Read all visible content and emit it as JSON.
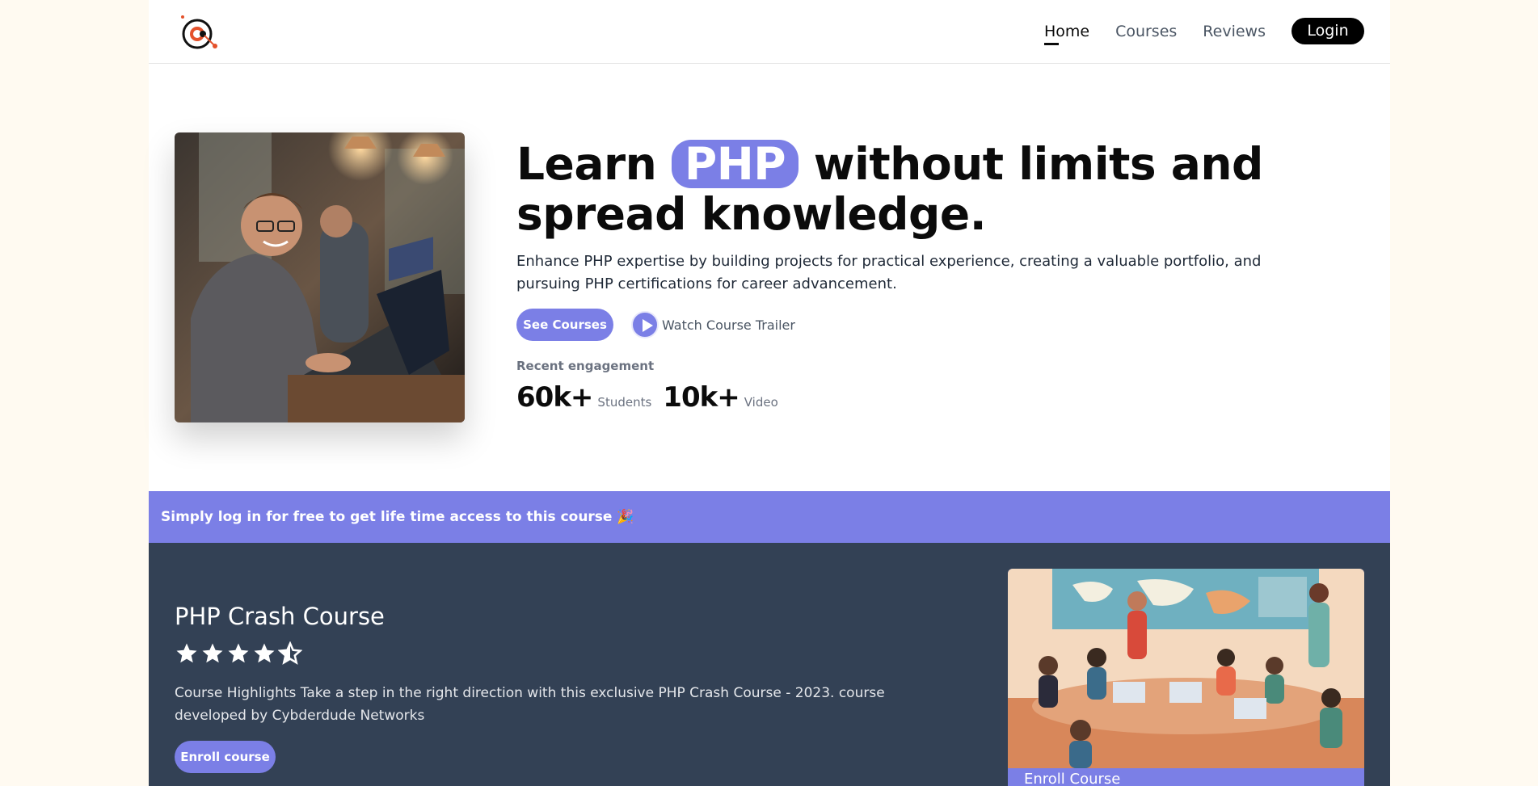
{
  "nav": {
    "links": [
      "Home",
      "Courses",
      "Reviews"
    ],
    "login_label": "Login"
  },
  "hero": {
    "title_pre": "Learn",
    "title_highlight": "PHP",
    "title_post": "without limits and spread knowledge.",
    "subtitle": "Enhance PHP expertise by building projects for practical experience, creating a valuable portfolio, and pursuing PHP certifications for career advancement.",
    "see_courses_label": "See Courses",
    "trailer_label": "Watch Course Trailer",
    "engagement_label": "Recent engagement",
    "stats": [
      {
        "value": "60k+",
        "label": "Students"
      },
      {
        "value": "10k+",
        "label": "Video"
      }
    ]
  },
  "banner": {
    "text": "Simply log in for free to get life time access to this course",
    "emoji": "🎉"
  },
  "course": {
    "title": "PHP Crash Course",
    "rating": 4.5,
    "description": "Course Highlights Take a step in the right direction with this exclusive PHP Crash Course - 2023. course developed by Cybderdude Networks",
    "enroll_label": "Enroll course",
    "card_button_label": "Enroll Course"
  },
  "colors": {
    "accent": "#7b7fe6",
    "dark": "#334155",
    "bg": "#fffaf1"
  }
}
